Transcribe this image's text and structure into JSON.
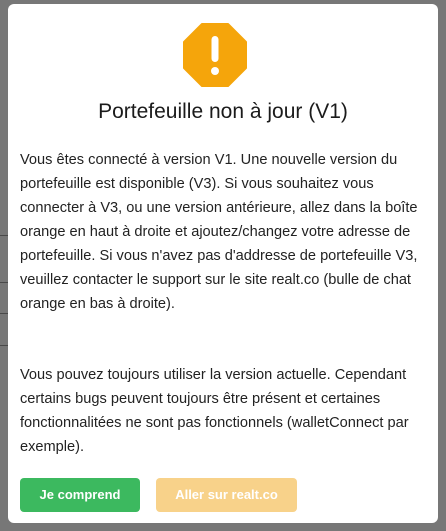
{
  "colors": {
    "warning_icon": "#f5a50b",
    "primary_button": "#3cb95f",
    "secondary_button": "#f8d28a",
    "overlay": "#5a5a5a"
  },
  "modal": {
    "icon": "exclamation-octagon-icon",
    "title": "Portefeuille non à jour (V1)",
    "paragraph_1": "Vous êtes connecté à version V1. Une nouvelle version du portefeuille est disponible (V3). Si vous souhaitez vous connecter à V3, ou une version antérieure, allez dans la boîte orange en haut à droite et ajoutez/changez votre adresse de portefeuille. Si vous n'avez pas d'addresse de portefeuille V3, veuillez contacter le support sur le site realt.co (bulle de chat orange en bas à droite).",
    "paragraph_2": "Vous pouvez toujours utiliser la version actuelle. Cependant certains bugs peuvent toujours être présent et certaines fonctionnalitées ne sont pas fonctionnels (walletConnect par exemple).",
    "primary_button": "Je comprend",
    "secondary_button": "Aller sur realt.co"
  }
}
